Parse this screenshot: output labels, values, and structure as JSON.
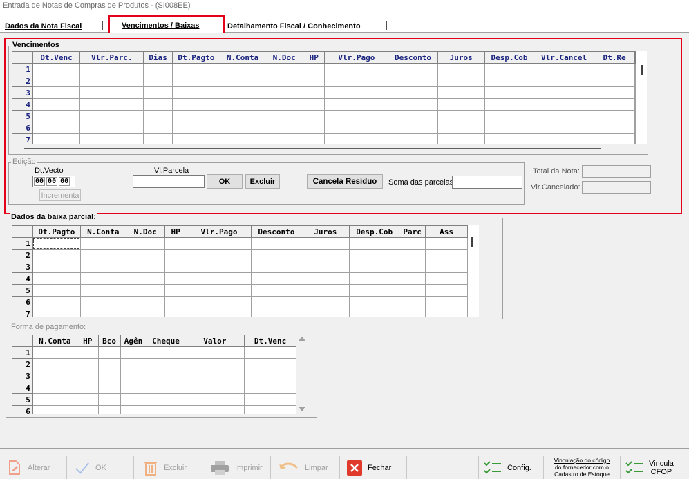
{
  "window": {
    "title": "Entrada de Notas de Compras de Produtos  - (SI008EE)"
  },
  "tabs": [
    {
      "label": "Dados da Nota Fiscal"
    },
    {
      "label": "Vencimentos / Baixas"
    },
    {
      "label": "Detalhamento Fiscal / Conhecimento"
    }
  ],
  "vencimentos": {
    "legend": "Vencimentos",
    "columns": [
      "Dt.Venc",
      "Vlr.Parc.",
      "Dias",
      "Dt.Pagto",
      "N.Conta",
      "N.Doc",
      "HP",
      "Vlr.Pago",
      "Desconto",
      "Juros",
      "Desp.Cob",
      "Vlr.Cancel",
      "Dt.Re"
    ],
    "rows": [
      "1",
      "2",
      "3",
      "4",
      "5",
      "6",
      "7"
    ]
  },
  "edicao": {
    "legend": "Edição",
    "dt_vecto_label": "Dt.Vecto",
    "dt_vecto_parts": [
      "00",
      "00",
      "00"
    ],
    "vl_parcela_label": "Vl.Parcela",
    "ok_label": "OK",
    "excluir_label": "Excluir",
    "incrementa_label": "Incrementa",
    "cancela_residuo_label": "Cancela Resíduo",
    "soma_parcelas_label": "Soma das parcelas:",
    "total_nota_label": "Total da Nota:",
    "vlr_cancelado_label": "Vlr.Cancelado:"
  },
  "baixa_parcial": {
    "legend": "Dados da baixa parcial:",
    "columns": [
      "Dt.Pagto",
      "N.Conta",
      "N.Doc",
      "HP",
      "Vlr.Pago",
      "Desconto",
      "Juros",
      "Desp.Cob",
      "Parc",
      "Ass"
    ],
    "rows": [
      "1",
      "2",
      "3",
      "4",
      "5",
      "6",
      "7"
    ]
  },
  "forma_pagamento": {
    "legend": "Forma de pagamento:",
    "columns": [
      "N.Conta",
      "HP",
      "Bco",
      "Agên",
      "Cheque",
      "Valor",
      "Dt.Venc"
    ],
    "rows": [
      "1",
      "2",
      "3",
      "4",
      "5",
      "6"
    ]
  },
  "toolbar": {
    "alterar": "Alterar",
    "ok": "OK",
    "excluir": "Excluir",
    "imprimir": "Imprimir",
    "limpar": "Limpar",
    "fechar": "Fechar",
    "config": "Config.",
    "vinculacao_line1": "Vinculação do código",
    "vinculacao_line2": "do fornecedor com o",
    "vinculacao_line3": "Cadastro de Estoque",
    "vincula_cfop_line1": "Vincula",
    "vincula_cfop_line2": "CFOP"
  },
  "colors": {
    "highlight": "#e3001b",
    "header_text": "#1a237e",
    "panel": "#f0f0f0"
  }
}
